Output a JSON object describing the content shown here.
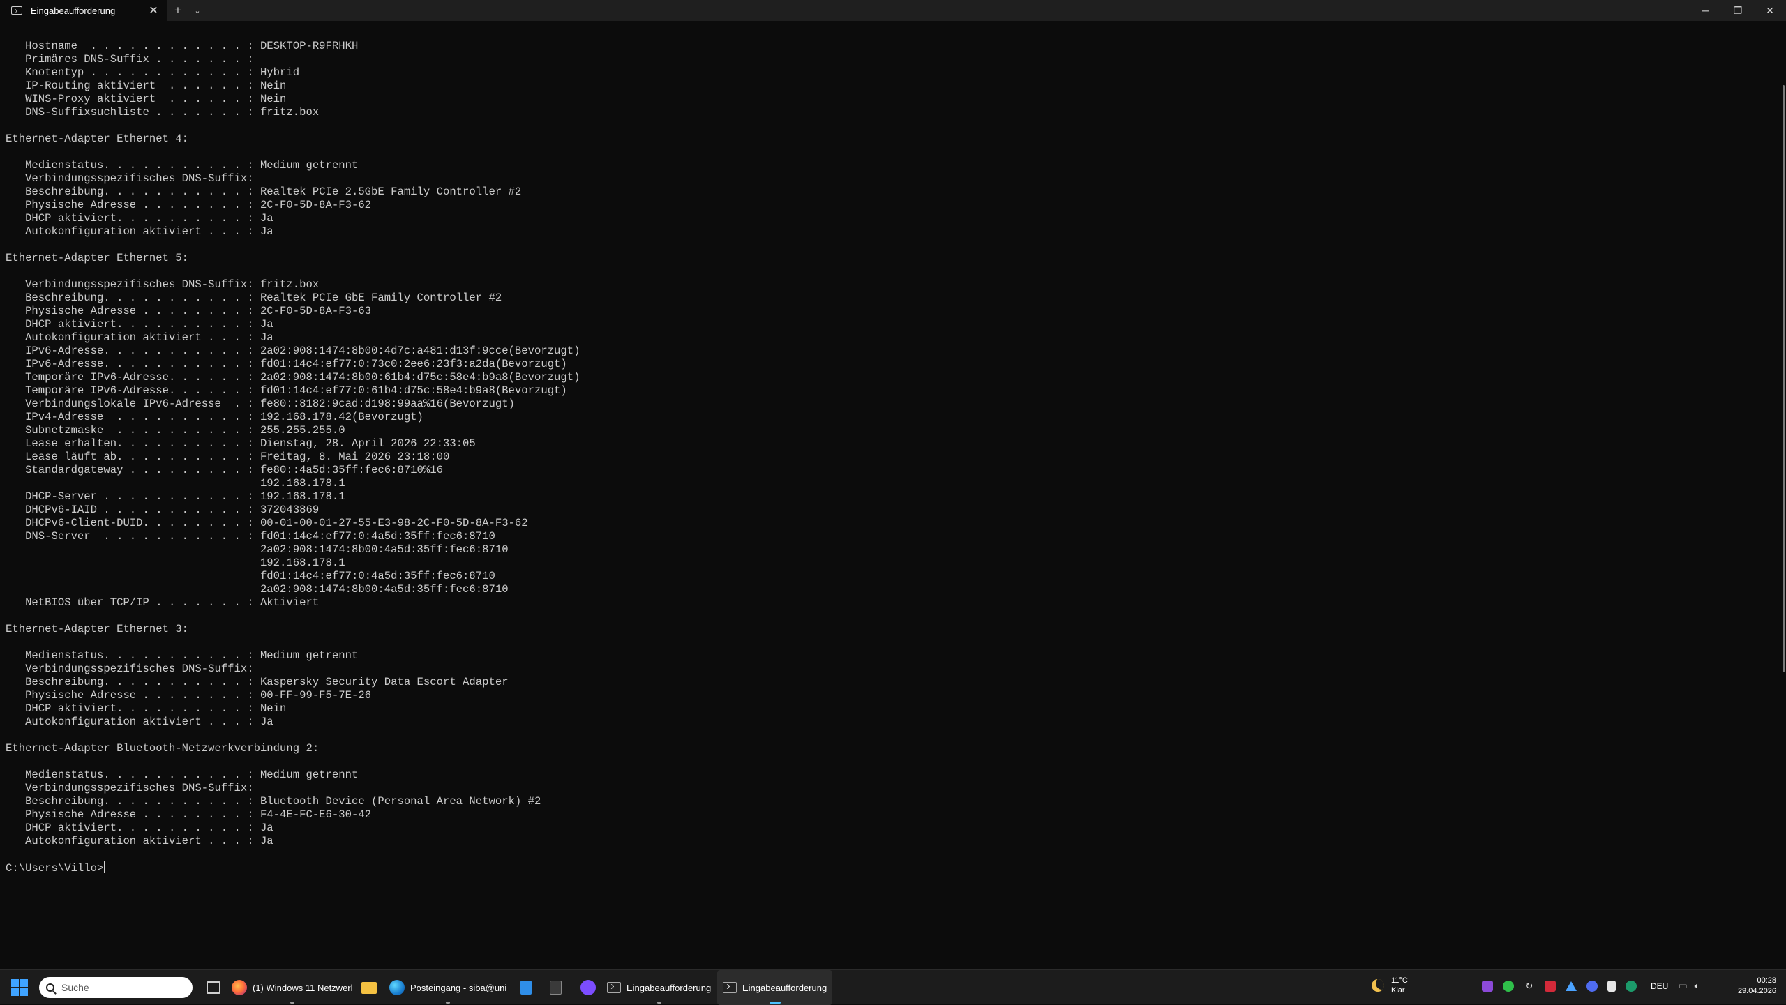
{
  "window": {
    "tab_title": "Eingabeaufforderung",
    "tab_close": "✕",
    "new_tab": "+",
    "tab_dropdown": "⌄",
    "minimize": "─",
    "maximize": "❐",
    "close": "✕"
  },
  "console": {
    "lines": [
      "   Hostname  . . . . . . . . . . . . : DESKTOP-R9FRHKH",
      "   Primäres DNS-Suffix . . . . . . . :",
      "   Knotentyp . . . . . . . . . . . . : Hybrid",
      "   IP-Routing aktiviert  . . . . . . : Nein",
      "   WINS-Proxy aktiviert  . . . . . . : Nein",
      "   DNS-Suffixsuchliste . . . . . . . : fritz.box",
      "",
      "Ethernet-Adapter Ethernet 4:",
      "",
      "   Medienstatus. . . . . . . . . . . : Medium getrennt",
      "   Verbindungsspezifisches DNS-Suffix:",
      "   Beschreibung. . . . . . . . . . . : Realtek PCIe 2.5GbE Family Controller #2",
      "   Physische Adresse . . . . . . . . : 2C-F0-5D-8A-F3-62",
      "   DHCP aktiviert. . . . . . . . . . : Ja",
      "   Autokonfiguration aktiviert . . . : Ja",
      "",
      "Ethernet-Adapter Ethernet 5:",
      "",
      "   Verbindungsspezifisches DNS-Suffix: fritz.box",
      "   Beschreibung. . . . . . . . . . . : Realtek PCIe GbE Family Controller #2",
      "   Physische Adresse . . . . . . . . : 2C-F0-5D-8A-F3-63",
      "   DHCP aktiviert. . . . . . . . . . : Ja",
      "   Autokonfiguration aktiviert . . . : Ja",
      "   IPv6-Adresse. . . . . . . . . . . : 2a02:908:1474:8b00:4d7c:a481:d13f:9cce(Bevorzugt)",
      "   IPv6-Adresse. . . . . . . . . . . : fd01:14c4:ef77:0:73c0:2ee6:23f3:a2da(Bevorzugt)",
      "   Temporäre IPv6-Adresse. . . . . . : 2a02:908:1474:8b00:61b4:d75c:58e4:b9a8(Bevorzugt)",
      "   Temporäre IPv6-Adresse. . . . . . : fd01:14c4:ef77:0:61b4:d75c:58e4:b9a8(Bevorzugt)",
      "   Verbindungslokale IPv6-Adresse  . : fe80::8182:9cad:d198:99aa%16(Bevorzugt)",
      "   IPv4-Adresse  . . . . . . . . . . : 192.168.178.42(Bevorzugt)",
      "   Subnetzmaske  . . . . . . . . . . : 255.255.255.0",
      "   Lease erhalten. . . . . . . . . . : Dienstag, 28. April 2026 22:33:05",
      "   Lease läuft ab. . . . . . . . . . : Freitag, 8. Mai 2026 23:18:00",
      "   Standardgateway . . . . . . . . . : fe80::4a5d:35ff:fec6:8710%16",
      "                                       192.168.178.1",
      "   DHCP-Server . . . . . . . . . . . : 192.168.178.1",
      "   DHCPv6-IAID . . . . . . . . . . . : 372043869",
      "   DHCPv6-Client-DUID. . . . . . . . : 00-01-00-01-27-55-E3-98-2C-F0-5D-8A-F3-62",
      "   DNS-Server  . . . . . . . . . . . : fd01:14c4:ef77:0:4a5d:35ff:fec6:8710",
      "                                       2a02:908:1474:8b00:4a5d:35ff:fec6:8710",
      "                                       192.168.178.1",
      "                                       fd01:14c4:ef77:0:4a5d:35ff:fec6:8710",
      "                                       2a02:908:1474:8b00:4a5d:35ff:fec6:8710",
      "   NetBIOS über TCP/IP . . . . . . . : Aktiviert",
      "",
      "Ethernet-Adapter Ethernet 3:",
      "",
      "   Medienstatus. . . . . . . . . . . : Medium getrennt",
      "   Verbindungsspezifisches DNS-Suffix:",
      "   Beschreibung. . . . . . . . . . . : Kaspersky Security Data Escort Adapter",
      "   Physische Adresse . . . . . . . . : 00-FF-99-F5-7E-26",
      "   DHCP aktiviert. . . . . . . . . . : Nein",
      "   Autokonfiguration aktiviert . . . : Ja",
      "",
      "Ethernet-Adapter Bluetooth-Netzwerkverbindung 2:",
      "",
      "   Medienstatus. . . . . . . . . . . : Medium getrennt",
      "   Verbindungsspezifisches DNS-Suffix:",
      "   Beschreibung. . . . . . . . . . . : Bluetooth Device (Personal Area Network) #2",
      "   Physische Adresse . . . . . . . . : F4-4E-FC-E6-30-42",
      "   DHCP aktiviert. . . . . . . . . . : Ja",
      "   Autokonfiguration aktiviert . . . : Ja",
      ""
    ],
    "prompt": "C:\\Users\\Villo>"
  },
  "taskbar": {
    "search_placeholder": "Suche",
    "apps": [
      {
        "label": "",
        "icon": "task-view-icon"
      },
      {
        "label": "(1) Windows 11 Netzwerl",
        "icon": "firefox-icon"
      },
      {
        "label": "",
        "icon": "file-explorer-icon"
      },
      {
        "label": "Posteingang - siba@uni",
        "icon": "thunderbird-icon"
      },
      {
        "label": "",
        "icon": "notepad-icon"
      },
      {
        "label": "",
        "icon": "calculator-icon"
      },
      {
        "label": "",
        "icon": "discord-icon"
      },
      {
        "label": "Eingabeaufforderung",
        "icon": "terminal-icon"
      },
      {
        "label": "Eingabeaufforderung",
        "icon": "terminal-icon"
      }
    ],
    "weather": {
      "temp": "11°C",
      "condition": "Klar"
    },
    "language": "DEU",
    "time": "00:28",
    "date": "29.04.2026"
  },
  "colors": {
    "console_bg": "#0c0c0c",
    "console_fg": "#cccccc",
    "taskbar_bg": "#1c1c1c",
    "accent": "#4cc2ff"
  }
}
